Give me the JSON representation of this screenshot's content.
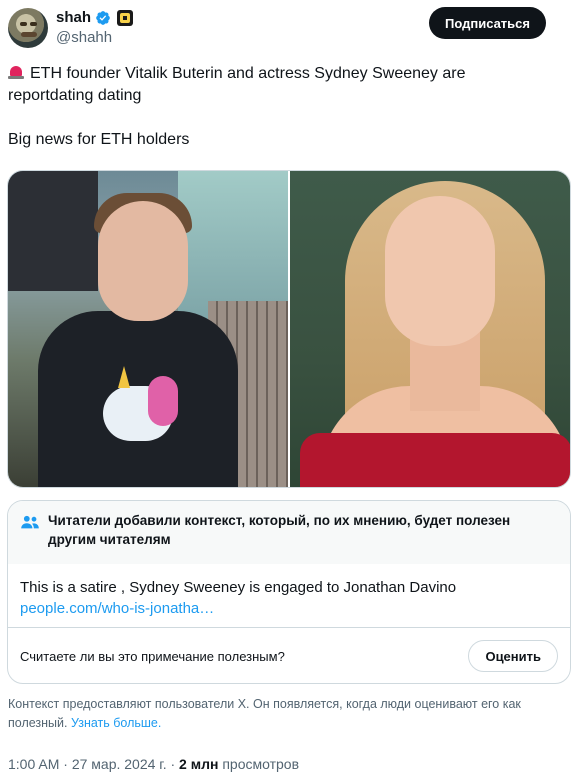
{
  "author": {
    "name": "shah",
    "handle": "@shahh",
    "verified": true,
    "follow_label": "Подписаться"
  },
  "tweet": {
    "line1": "ETH founder Vitalik Buterin and actress Sydney Sweeney are",
    "line2": "reportdating dating",
    "line3": "Big news for ETH holders",
    "emoji_icon": "siren-icon"
  },
  "community_note": {
    "title_line1": "Читатели добавили контекст, который, по их мнению, будет полезен",
    "title_line2": "другим читателям",
    "text": "This is a satire , Sydney Sweeney is engaged to Jonathan Davino",
    "link": "people.com/who-is-jonatha…",
    "question": "Считаете ли вы это примечание полезным?",
    "rate_label": "Оценить"
  },
  "footnote": {
    "text_line1": "Контекст предоставляют пользователи X. Он появляется, когда люди оценивают его как",
    "text_line2": "полезный.",
    "learn_more": "Узнать больше."
  },
  "meta": {
    "time": "1:00 AM",
    "sep1": "·",
    "date": "27 мар. 2024 г.",
    "sep2": "·",
    "views_count": "2 млн",
    "views_label": "просмотров"
  },
  "colors": {
    "accent": "#1d9bf0",
    "text": "#0f1419",
    "muted": "#536471",
    "border": "#cfd9de"
  }
}
